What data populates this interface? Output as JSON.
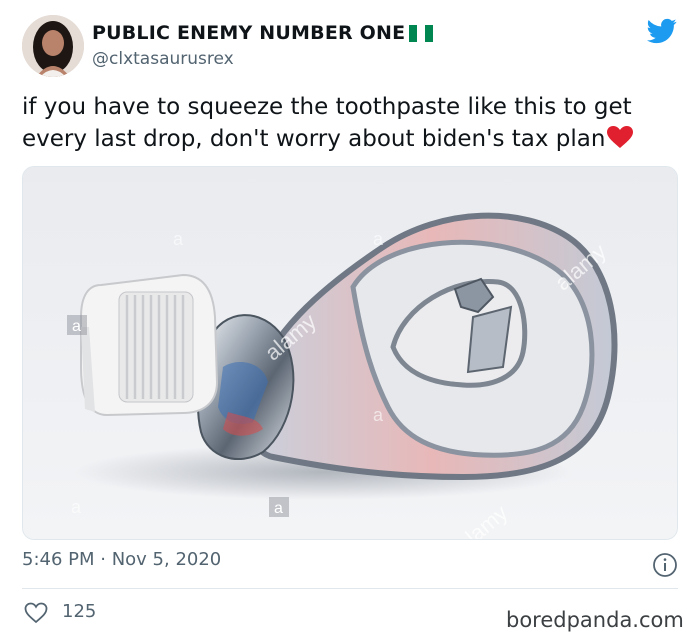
{
  "tweet": {
    "display_name": "PUBLIC ENEMY NUMBER ONE",
    "handle": "@clxtasaurusrex",
    "text": "if you have to squeeze the toothpaste like this to get every last drop, don't worry about biden's tax plan",
    "timestamp": "5:46 PM · Nov 5, 2020",
    "like_count": "125"
  },
  "icons": {
    "flag": "nigeria-flag-icon",
    "logo": "twitter-bird-icon",
    "emoji": "red-heart-icon",
    "info": "info-icon",
    "like": "heart-outline-icon"
  },
  "colors": {
    "twitter_blue": "#1d9bf0",
    "flag_green": "#008751",
    "secondary_text": "#536471",
    "heart_red": "#e0202e"
  },
  "media": {
    "stock_marks": [
      "a",
      "a",
      "a",
      "alamy",
      "alamy",
      "a",
      "a",
      "a",
      "alamy"
    ]
  },
  "watermark": "boredpanda.com"
}
